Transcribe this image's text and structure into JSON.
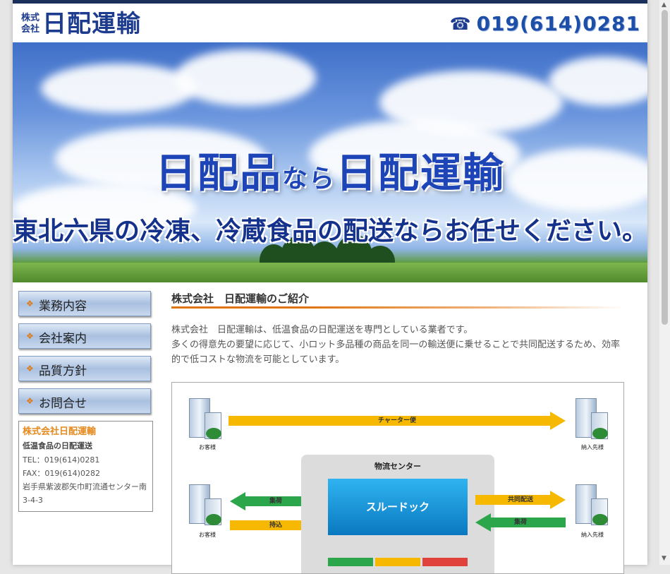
{
  "header": {
    "logo_prefix_line1": "株式",
    "logo_prefix_line2": "会社",
    "logo_name": "日配運輸",
    "phone_icon": "telephone-icon",
    "phone": "019(614)0281"
  },
  "hero": {
    "title_part1": "日配品",
    "title_part2": "なら",
    "title_part3": "日配運輸",
    "subtitle": "東北六県の冷凍、冷蔵食品の配送ならお任せください。"
  },
  "nav": [
    {
      "label": "業務内容"
    },
    {
      "label": "会社案内"
    },
    {
      "label": "品質方針"
    },
    {
      "label": "お問合せ"
    }
  ],
  "info": {
    "company": "株式会社日配運輸",
    "tagline": "低温食品の日配運送",
    "tel": "TEL：019(614)0281",
    "fax": "FAX：019(614)0282",
    "address": "岩手県紫波郡矢巾町流通センター南3-4-3"
  },
  "main": {
    "title": "株式会社　日配運輸のご紹介",
    "intro_line1": "株式会社　日配運輸は、低温食品の日配運送を専門としている業者です。",
    "intro_line2": "多くの得意先の要望に応じて、小ロット多品種の商品を同一の輸送便に乗せることで共同配送するため、効率的で低コストな物流を可能としています。"
  },
  "diagram": {
    "charter": "チャーター便",
    "customer": "お客様",
    "destination": "納入先様",
    "center": "物流センター",
    "dock": "スルードック",
    "collect": "集荷",
    "bring": "持込",
    "joint": "共同配送",
    "collect2": "集荷",
    "colors": {
      "yellow": "#f6b800",
      "green": "#2ca64a",
      "red": "#e0413a"
    }
  }
}
